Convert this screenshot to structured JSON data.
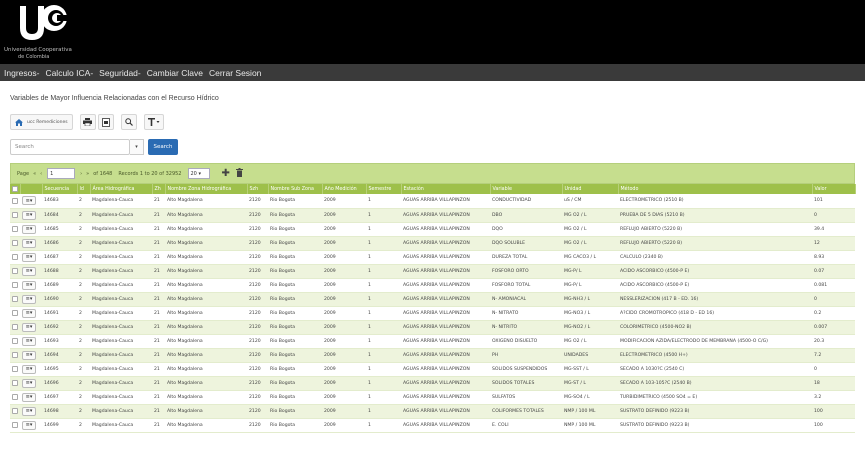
{
  "header": {
    "logo_line1": "Universidad Cooperativa",
    "logo_line2": "de Colombia"
  },
  "nav": [
    {
      "label": "Ingresos-"
    },
    {
      "label": "Calculo ICA-"
    },
    {
      "label": "Seguridad-"
    },
    {
      "label": "Cambiar Clave"
    },
    {
      "label": "Cerrar Sesion"
    }
  ],
  "page": {
    "title": "Variables de Mayor Influencia Relacionadas con el Recurso Hídrico"
  },
  "toolbar": {
    "home_label": "ucc Remediciones"
  },
  "search": {
    "placeholder": "Search",
    "button_label": "Search"
  },
  "pager": {
    "page_label": "Page",
    "page_value": "1",
    "of_pages": "of 1648",
    "records_text": "Records 1 to 20 of 32952",
    "page_size": "20"
  },
  "columns": [
    "",
    "",
    "Secuencia",
    "Id",
    "Área Hidrográfica",
    "Zh",
    "Nombre Zona Hidrográfica",
    "Szh",
    "Nombre Sub Zona",
    "Año Medición",
    "Semestre",
    "Estación",
    "Variable",
    "Unidad",
    "Método",
    "Valor"
  ],
  "rows": [
    [
      "14683",
      "2",
      "Magdalena-Cauca",
      "21",
      "Alto Magdalena",
      "2120",
      "Rio Bogota",
      "2009",
      "1",
      "AGUAS ARRIBA VILLAPINZON",
      "CONDUCTIVIDAD",
      "uS / CM",
      "ELECTROMETRICO (2510 B)",
      "101"
    ],
    [
      "14684",
      "2",
      "Magdalena-Cauca",
      "21",
      "Alto Magdalena",
      "2120",
      "Rio Bogota",
      "2009",
      "1",
      "AGUAS ARRIBA VILLAPINZON",
      "DBO",
      "MG O2 / L",
      "PRUEBA DE 5 DIAS (5210 B)",
      "0"
    ],
    [
      "14685",
      "2",
      "Magdalena-Cauca",
      "21",
      "Alto Magdalena",
      "2120",
      "Rio Bogota",
      "2009",
      "1",
      "AGUAS ARRIBA VILLAPINZON",
      "DQO",
      "MG O2 / L",
      "REFLUJO ABIERTO (5220 B)",
      "39.4"
    ],
    [
      "14686",
      "2",
      "Magdalena-Cauca",
      "21",
      "Alto Magdalena",
      "2120",
      "Rio Bogota",
      "2009",
      "1",
      "AGUAS ARRIBA VILLAPINZON",
      "DQO SOLUBLE",
      "MG O2 / L",
      "REFLUJO ABIERTO (5220 B)",
      "12"
    ],
    [
      "14687",
      "2",
      "Magdalena-Cauca",
      "21",
      "Alto Magdalena",
      "2120",
      "Rio Bogota",
      "2009",
      "1",
      "AGUAS ARRIBA VILLAPINZON",
      "DUREZA TOTAL",
      "MG CACO3 / L",
      "CALCULO (2340 B)",
      "8.93"
    ],
    [
      "14688",
      "2",
      "Magdalena-Cauca",
      "21",
      "Alto Magdalena",
      "2120",
      "Rio Bogota",
      "2009",
      "1",
      "AGUAS ARRIBA VILLAPINZON",
      "FOSFORO ORTO",
      "MG-P/ L",
      "ACIDO ASCORBICO (4500-P E)",
      "0.07"
    ],
    [
      "14689",
      "2",
      "Magdalena-Cauca",
      "21",
      "Alto Magdalena",
      "2120",
      "Rio Bogota",
      "2009",
      "1",
      "AGUAS ARRIBA VILLAPINZON",
      "FOSFORO TOTAL",
      "MG-P/ L",
      "ACIDO ASCORBICO (4500-P E)",
      "0.081"
    ],
    [
      "14690",
      "2",
      "Magdalena-Cauca",
      "21",
      "Alto Magdalena",
      "2120",
      "Rio Bogota",
      "2009",
      "1",
      "AGUAS ARRIBA VILLAPINZON",
      "N- AMONIACAL",
      "MG-NH3 / L",
      "NESSLERIZACION (417 B - ED. 16)",
      "0"
    ],
    [
      "14691",
      "2",
      "Magdalena-Cauca",
      "21",
      "Alto Magdalena",
      "2120",
      "Rio Bogota",
      "2009",
      "1",
      "AGUAS ARRIBA VILLAPINZON",
      "N- NITRATO",
      "MG-NO3 / L",
      "A?CIDO CROMOTROPICO (418 D - ED 16)",
      "0.2"
    ],
    [
      "14692",
      "2",
      "Magdalena-Cauca",
      "21",
      "Alto Magdalena",
      "2120",
      "Rio Bogota",
      "2009",
      "1",
      "AGUAS ARRIBA VILLAPINZON",
      "N- NITRITO",
      "MG-NO2 / L",
      "COLORIMETRICO (4500-NO2 B)",
      "0.007"
    ],
    [
      "14693",
      "2",
      "Magdalena-Cauca",
      "21",
      "Alto Magdalena",
      "2120",
      "Rio Bogota",
      "2009",
      "1",
      "AGUAS ARRIBA VILLAPINZON",
      "OXIGENO DISUELTO",
      "MG O2 / L",
      "MODIFICACION AZIDA/ELECTRODO DE MEMBRANA (4500-O C/G)",
      "20.3"
    ],
    [
      "14694",
      "2",
      "Magdalena-Cauca",
      "21",
      "Alto Magdalena",
      "2120",
      "Rio Bogota",
      "2009",
      "1",
      "AGUAS ARRIBA VILLAPINZON",
      "PH",
      "UNIDADES",
      "ELECTROMETRICO (4500 H+)",
      "7.2"
    ],
    [
      "14695",
      "2",
      "Magdalena-Cauca",
      "21",
      "Alto Magdalena",
      "2120",
      "Rio Bogota",
      "2009",
      "1",
      "AGUAS ARRIBA VILLAPINZON",
      "SOLIDOS SUSPENDIDOS",
      "MG-SST / L",
      "SECADO A 1030?C (2540 C)",
      "0"
    ],
    [
      "14696",
      "2",
      "Magdalena-Cauca",
      "21",
      "Alto Magdalena",
      "2120",
      "Rio Bogota",
      "2009",
      "1",
      "AGUAS ARRIBA VILLAPINZON",
      "SOLIDOS TOTALES",
      "MG-ST / L",
      "SECADO A 103-105?C (2540 B)",
      "18"
    ],
    [
      "14697",
      "2",
      "Magdalena-Cauca",
      "21",
      "Alto Magdalena",
      "2120",
      "Rio Bogota",
      "2009",
      "1",
      "AGUAS ARRIBA VILLAPINZON",
      "SULFATOS",
      "MG-SO4 / L",
      "TURBIDIMETRICO (4500 SO4 = E)",
      "3.2"
    ],
    [
      "14698",
      "2",
      "Magdalena-Cauca",
      "21",
      "Alto Magdalena",
      "2120",
      "Rio Bogota",
      "2009",
      "1",
      "AGUAS ARRIBA VILLAPINZON",
      "COLIFORMES TOTALES",
      "NMP / 100 ML",
      "SUSTRATO DEFINIDO (9223 B)",
      "100"
    ],
    [
      "14699",
      "2",
      "Magdalena-Cauca",
      "21",
      "Alto Magdalena",
      "2120",
      "Rio Bogota",
      "2009",
      "1",
      "AGUAS ARRIBA VILLAPINZON",
      "E. COLI",
      "NMP / 100 ML",
      "SUSTRATO DEFINIDO (9223 B)",
      "100"
    ]
  ]
}
